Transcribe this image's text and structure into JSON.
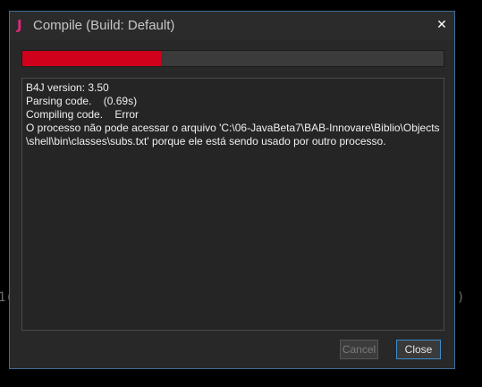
{
  "background": {
    "left_fragment": "1(",
    "right_fragment": ")"
  },
  "dialog": {
    "icon_glyph": "J",
    "icon_name": "b4j-app-icon",
    "title": "Compile (Build: Default)",
    "close_glyph": "✕",
    "progress": {
      "fraction": 0.33,
      "fill_color": "#d0021b"
    },
    "log_lines": [
      "B4J version: 3.50",
      "Parsing code.    (0.69s)",
      "Compiling code.    Error",
      "O processo não pode acessar o arquivo 'C:\\06-JavaBeta7\\BAB-Innovare\\Biblio\\Objects",
      "\\shell\\bin\\classes\\subs.txt' porque ele está sendo usado por outro processo."
    ],
    "buttons": {
      "cancel_label": "Cancel",
      "cancel_enabled": false,
      "close_label": "Close"
    }
  },
  "colors": {
    "accent_border": "#3d6e99",
    "icon_color": "#e0287a"
  }
}
